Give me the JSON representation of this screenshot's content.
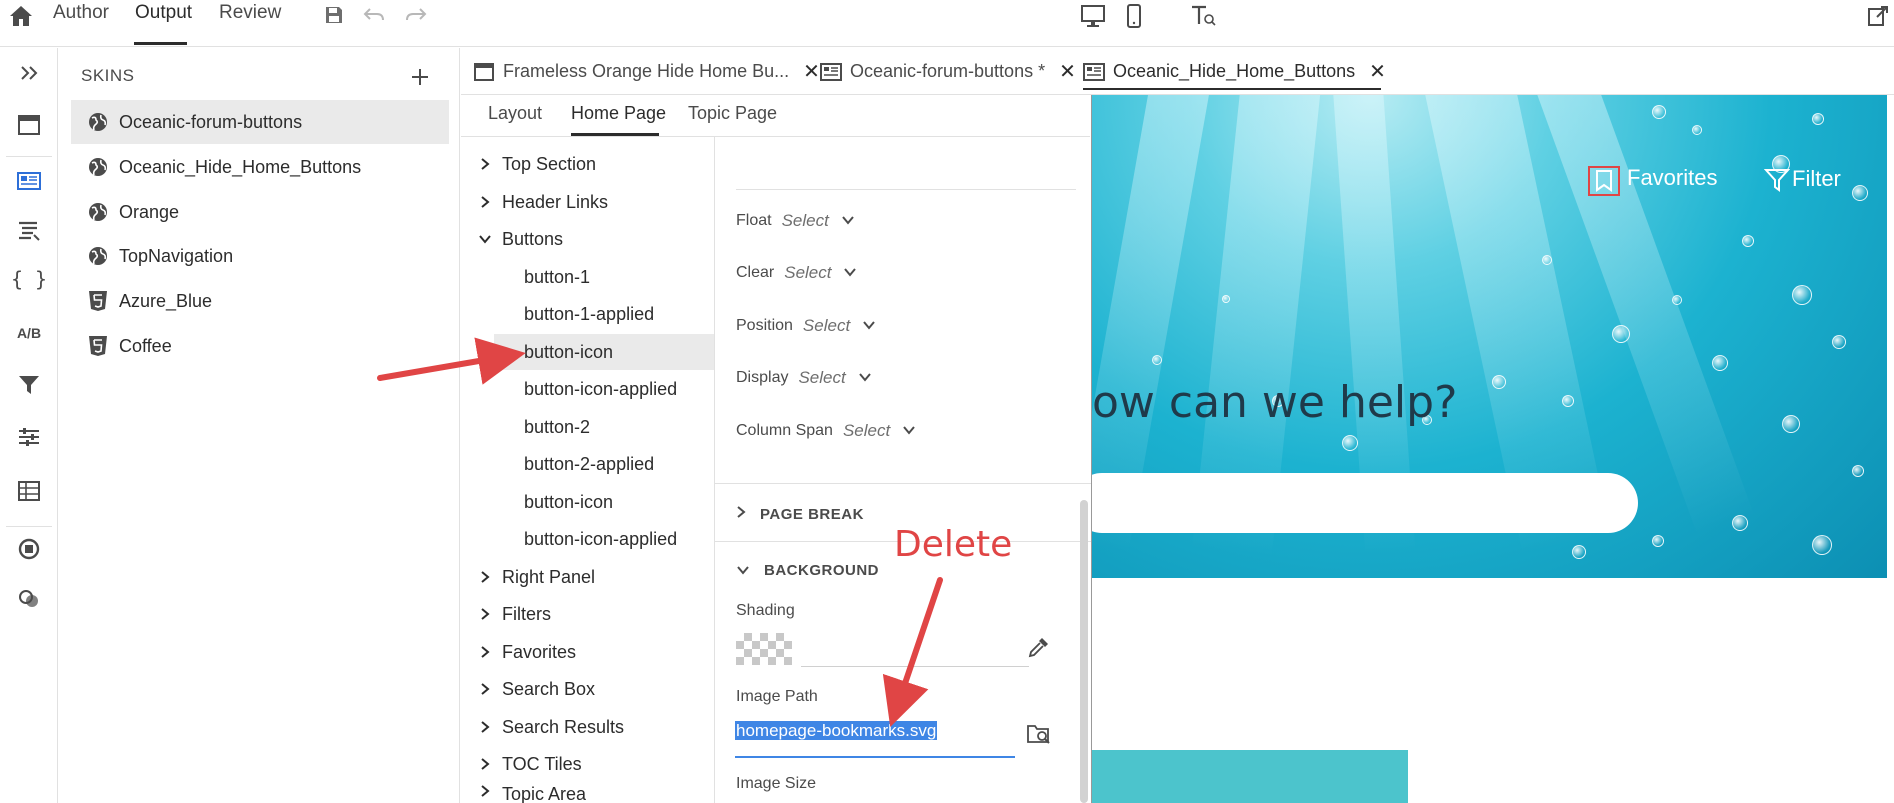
{
  "top_tabs": [
    {
      "label": "Author"
    },
    {
      "label": "Output"
    },
    {
      "label": "Review"
    }
  ],
  "skins": {
    "title": "SKINS",
    "items": [
      {
        "label": "Oceanic-forum-buttons",
        "icon": "globe-icon"
      },
      {
        "label": "Oceanic_Hide_Home_Buttons",
        "icon": "globe-icon"
      },
      {
        "label": "Orange",
        "icon": "globe-icon"
      },
      {
        "label": "TopNavigation",
        "icon": "globe-icon"
      },
      {
        "label": "Azure_Blue",
        "icon": "html5-icon"
      },
      {
        "label": "Coffee",
        "icon": "html5-icon"
      }
    ]
  },
  "rail": {
    "ab_label": "A/B",
    "braces_label": "{ }"
  },
  "doc_tabs": [
    {
      "label": "Frameless Orange Hide Home Bu...",
      "close": "✕"
    },
    {
      "label": "Oceanic-forum-buttons *",
      "close": "✕"
    },
    {
      "label": "Oceanic_Hide_Home_Buttons",
      "close": "✕"
    }
  ],
  "sub_tabs": [
    {
      "label": "Layout"
    },
    {
      "label": "Home Page"
    },
    {
      "label": "Topic Page"
    }
  ],
  "tree": {
    "top": [
      {
        "label": "Top Section"
      },
      {
        "label": "Header Links"
      },
      {
        "label": "Buttons"
      }
    ],
    "children": [
      {
        "label": "button-1"
      },
      {
        "label": "button-1-applied"
      },
      {
        "label": "button-icon"
      },
      {
        "label": "button-icon-applied"
      },
      {
        "label": "button-2"
      },
      {
        "label": "button-2-applied"
      },
      {
        "label": "button-icon"
      },
      {
        "label": "button-icon-applied"
      }
    ],
    "bottom": [
      {
        "label": "Right Panel"
      },
      {
        "label": "Filters"
      },
      {
        "label": "Favorites"
      },
      {
        "label": "Search Box"
      },
      {
        "label": "Search Results"
      },
      {
        "label": "TOC Tiles"
      },
      {
        "label": "Topic Area"
      }
    ]
  },
  "props": {
    "float": {
      "label": "Float",
      "value": "Select"
    },
    "clear": {
      "label": "Clear",
      "value": "Select"
    },
    "position": {
      "label": "Position",
      "value": "Select"
    },
    "display": {
      "label": "Display",
      "value": "Select"
    },
    "column_span": {
      "label": "Column Span",
      "value": "Select"
    },
    "page_break": "PAGE BREAK",
    "background": "BACKGROUND",
    "shading": "Shading",
    "image_path_label": "Image Path",
    "image_path_value": "homepage-bookmarks.svg",
    "image_size": "Image Size"
  },
  "preview": {
    "favorites": "Favorites",
    "filter": "Filter",
    "help": "ow can we help?"
  },
  "annotation": {
    "delete": "Delete",
    "color": "#e04545"
  },
  "colors": {
    "accent": "#3f86e5",
    "rail_active": "#2d6fd8",
    "selection": "#eaeaea"
  }
}
